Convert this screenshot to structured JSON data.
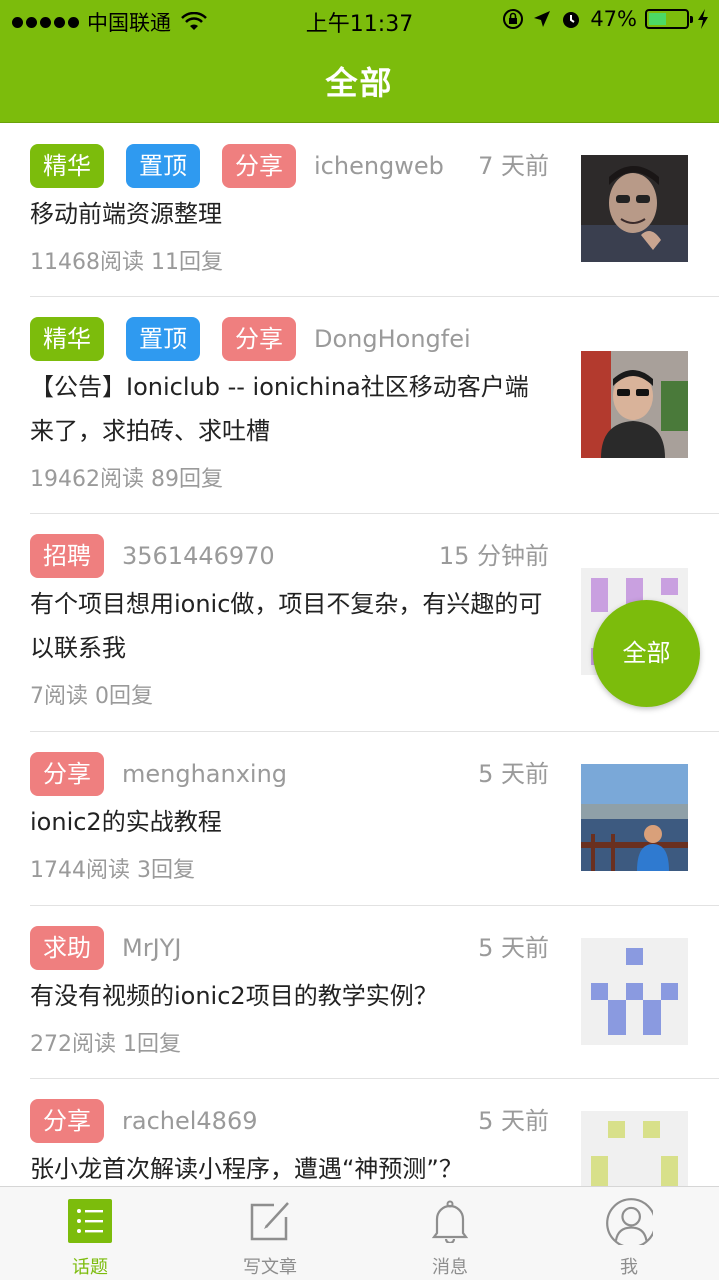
{
  "status_bar": {
    "carrier": "中国联通",
    "time": "上午11:37",
    "battery": "47%",
    "battery_level": 0.47
  },
  "header": {
    "title": "全部"
  },
  "topics": [
    {
      "tags": [
        "精华",
        "置顶",
        "分享"
      ],
      "author": "ichengweb",
      "time": "7 天前",
      "title": "移动前端资源整理",
      "stats": "11468阅读 11回复",
      "avatar": "photo-man-glasses"
    },
    {
      "tags": [
        "精华",
        "置顶",
        "分享"
      ],
      "author": "DongHongfei",
      "time": "",
      "title": "【公告】Ioniclub -- ionichina社区移动客户端来了，求拍砖、求吐槽",
      "stats": "19462阅读 89回复",
      "avatar": "photo-man-sunglasses"
    },
    {
      "tags": [
        "招聘"
      ],
      "author": "3561446970",
      "time": "15 分钟前",
      "title": "有个项目想用ionic做，项目不复杂，有兴趣的可以联系我",
      "stats": "7阅读 0回复",
      "avatar": "identicon-purple"
    },
    {
      "tags": [
        "分享"
      ],
      "author": "menghanxing",
      "time": "5 天前",
      "title": "ionic2的实战教程",
      "stats": "1744阅读 3回复",
      "avatar": "photo-seaside"
    },
    {
      "tags": [
        "求助"
      ],
      "author": "MrJYJ",
      "time": "5 天前",
      "title": "有没有视频的ionic2项目的教学实例？",
      "stats": "272阅读 1回复",
      "avatar": "identicon-blue"
    },
    {
      "tags": [
        "分享"
      ],
      "author": "rachel4869",
      "time": "5 天前",
      "title": "张小龙首次解读小程序，遭遇“神预测”？",
      "stats": "",
      "avatar": "identicon-yellowgreen"
    }
  ],
  "fab": {
    "label": "全部"
  },
  "tabbar": {
    "items": [
      {
        "label": "话题",
        "icon": "list-icon",
        "active": true
      },
      {
        "label": "写文章",
        "icon": "edit-icon",
        "active": false
      },
      {
        "label": "消息",
        "icon": "bell-icon",
        "active": false
      },
      {
        "label": "我",
        "icon": "user-icon",
        "active": false
      }
    ]
  },
  "colors": {
    "brand": "#7cbc0c",
    "pin": "#2f9af0",
    "share": "#ef7f7f",
    "text": "#222222",
    "muted": "#9a9a9a"
  }
}
